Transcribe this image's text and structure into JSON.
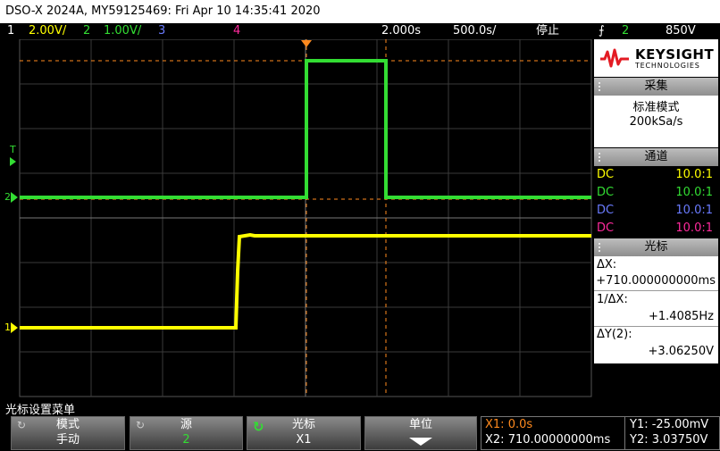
{
  "title": "DSO-X 2024A, MY59125469: Fri Apr 10 14:35:41 2020",
  "status": {
    "ch1_num": "1",
    "ch1_scale": "2.00V/",
    "ch2_num": "2",
    "ch2_scale": "1.00V/",
    "ch3_num": "3",
    "ch4_num": "4",
    "time_delay": "2.000s",
    "time_scale": "500.0s/",
    "run_state": "停止",
    "trig_symbol": "⨍",
    "trig_src": "2",
    "trig_level": "850V"
  },
  "markers": {
    "t": "T",
    "ch1": "1",
    "ch2": "2"
  },
  "side": {
    "brand": "KEYSIGHT",
    "brand_sub": "TECHNOLOGIES",
    "acq_title": "采集",
    "acq_mode": "标准模式",
    "acq_rate": "200kSa/s",
    "ch_title": "通道",
    "channels": [
      {
        "coupling": "DC",
        "probe": "10.0:1"
      },
      {
        "coupling": "DC",
        "probe": "10.0:1"
      },
      {
        "coupling": "DC",
        "probe": "10.0:1"
      },
      {
        "coupling": "DC",
        "probe": "10.0:1"
      }
    ],
    "cursor_title": "光标",
    "dx_label": "ΔX:",
    "dx_value": "+710.000000000ms",
    "inv_dx_label": "1/ΔX:",
    "inv_dx_value": "+1.4085Hz",
    "dy_label": "ΔY(2):",
    "dy_value": "+3.06250V"
  },
  "softkeys": {
    "menu_title": "光标设置菜单",
    "mode_label": "模式",
    "mode_value": "手动",
    "source_label": "源",
    "source_value": "2",
    "cursor_label": "光标",
    "cursor_value": "X1",
    "unit_label": "单位"
  },
  "readout": {
    "x1": "X1: 0.0s",
    "x2": "X2: 710.00000000ms",
    "y1": "Y1: -25.00mV",
    "y2": "Y2: 3.03750V"
  },
  "colors": {
    "ch1": "#ffff00",
    "ch2": "#33dd33",
    "ch3": "#6a7bff",
    "ch4": "#ff2a9d",
    "cursor": "#ff8a1e"
  }
}
